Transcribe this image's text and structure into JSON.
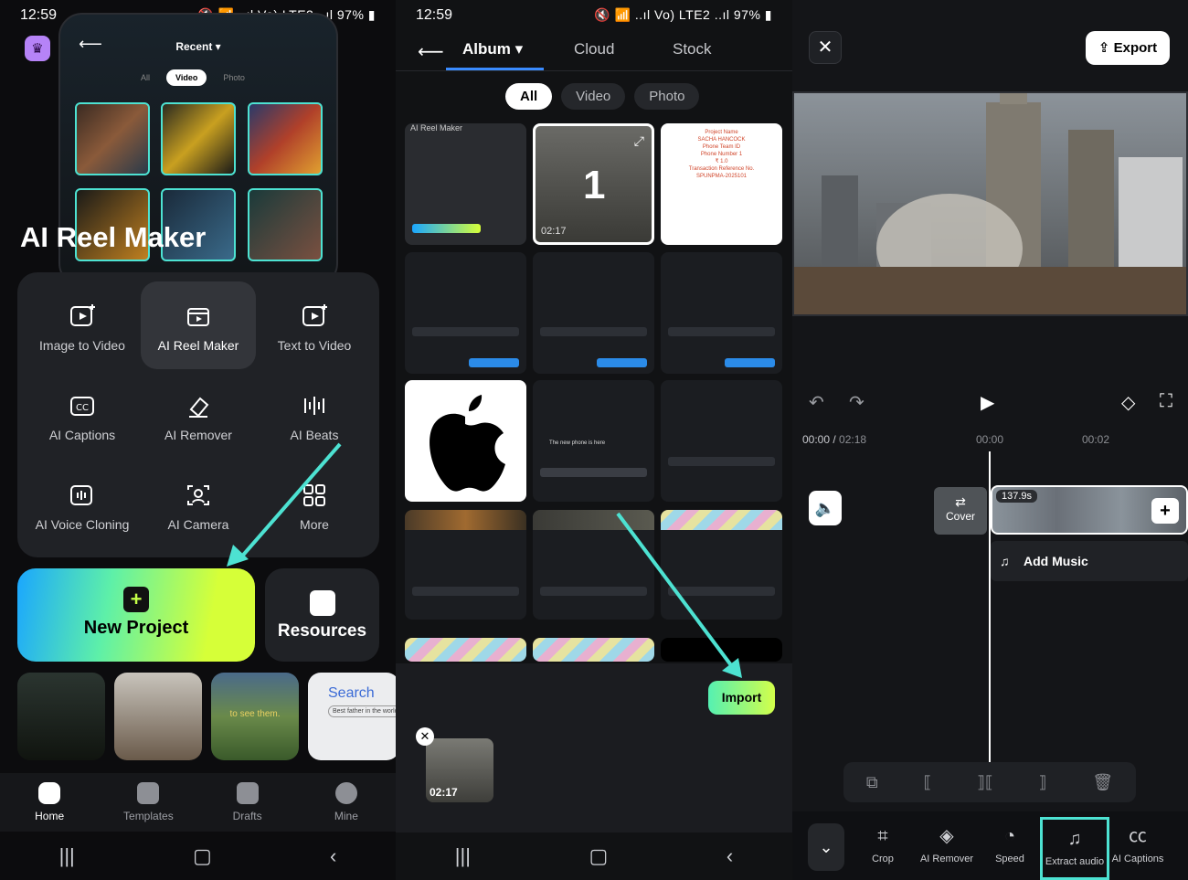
{
  "panel1": {
    "status_time": "12:59",
    "status_right": "🔇 📶 ..ıl Vo) LTE2 ..ıl 97% ▮",
    "inner_back": "⟵",
    "inner_recent": "Recent ▾",
    "inner_tabs": [
      "All",
      "Video",
      "Photo"
    ],
    "title": "AI Reel Maker",
    "tools": [
      {
        "label": "Image to Video",
        "icon": "image-to-video-icon"
      },
      {
        "label": "AI Reel Maker",
        "icon": "reel-maker-icon"
      },
      {
        "label": "Text to Video",
        "icon": "text-to-video-icon"
      },
      {
        "label": "AI Captions",
        "icon": "captions-icon"
      },
      {
        "label": "AI Remover",
        "icon": "eraser-icon"
      },
      {
        "label": "AI Beats",
        "icon": "beats-icon"
      },
      {
        "label": "AI Voice Cloning",
        "icon": "voice-cloning-icon"
      },
      {
        "label": "AI Camera",
        "icon": "camera-icon"
      },
      {
        "label": "More",
        "icon": "grid-icon"
      }
    ],
    "new_project": "New Project",
    "resources": "Resources",
    "search_thumb_text": "Search",
    "search_thumb_input": "Best father in the world",
    "landscape_thumb_text": "to see them.",
    "tabbar": [
      {
        "label": "Home",
        "icon": "home-icon"
      },
      {
        "label": "Templates",
        "icon": "templates-icon"
      },
      {
        "label": "Drafts",
        "icon": "drafts-icon"
      },
      {
        "label": "Mine",
        "icon": "profile-icon"
      }
    ]
  },
  "panel2": {
    "status_time": "12:59",
    "status_right": "🔇 📶 ..ıl Vo) LTE2 ..ıl 97% ▮",
    "tabs": [
      "Album ▾",
      "Cloud",
      "Stock"
    ],
    "filters": [
      "All",
      "Video",
      "Photo"
    ],
    "first_cell_caption": "AI Reel Maker",
    "selected_badge": "1",
    "selected_duration": "02:17",
    "receipt_lines": [
      "Project Name",
      "SACHA HANCOCK",
      "Phone Team ID",
      "Phone Number 1",
      "₹ 1.0 ",
      "Transaction Reference No.",
      "SPUNPMA-2025101"
    ],
    "editor_text_input": "The new phone is here",
    "import": "Import",
    "tray_duration": "02:17"
  },
  "panel3": {
    "export": "Export",
    "time_current": "00:00",
    "time_total": "02:18",
    "ruler": [
      "00:00",
      "00:02"
    ],
    "cover": "Cover",
    "clip_duration": "137.9s",
    "add_music": "Add Music",
    "bottom_tools": [
      {
        "label": "Crop",
        "icon": "crop-icon"
      },
      {
        "label": "AI Remover",
        "icon": "ai-remover-icon"
      },
      {
        "label": "Speed",
        "icon": "speed-icon"
      },
      {
        "label": "Extract audio",
        "icon": "extract-audio-icon"
      },
      {
        "label": "AI Captions",
        "icon": "ai-captions-icon"
      }
    ]
  },
  "colors": {
    "accent": "#4de2d2",
    "gradient_start": "#1aa6ff",
    "gradient_end": "#d6ff38",
    "tab_underline": "#3a8bff"
  }
}
